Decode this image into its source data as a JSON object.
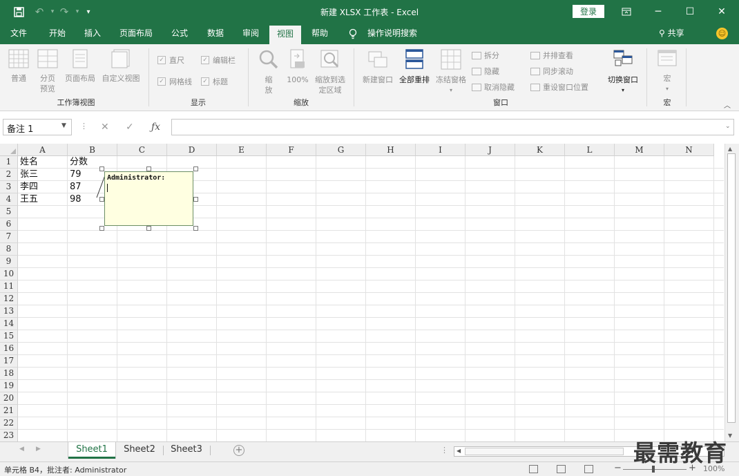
{
  "app": {
    "title": "新建 XLSX 工作表 - Excel",
    "login_label": "登录"
  },
  "menu": {
    "tabs": [
      "文件",
      "开始",
      "插入",
      "页面布局",
      "公式",
      "数据",
      "审阅",
      "视图",
      "帮助"
    ],
    "active": "视图",
    "tell_me": "操作说明搜索",
    "share": "共享"
  },
  "ribbon": {
    "workbook_views": {
      "label": "工作簿视图",
      "buttons": [
        "普通",
        "分页预览",
        "页面布局",
        "自定义视图"
      ]
    },
    "show": {
      "label": "显示",
      "checks": [
        "直尺",
        "编辑栏",
        "网格线",
        "标题"
      ]
    },
    "zoom": {
      "label": "缩放",
      "buttons": [
        "缩放",
        "100%",
        "缩放到选定区域"
      ]
    },
    "window": {
      "label": "窗口",
      "buttons": [
        "新建窗口",
        "全部重排",
        "冻结窗格",
        "拆分",
        "隐藏",
        "取消隐藏",
        "并排查看",
        "同步滚动",
        "重设窗口位置",
        "切换窗口"
      ]
    },
    "macros": {
      "label": "宏",
      "buttons": [
        "宏"
      ]
    }
  },
  "formula_bar": {
    "name_box": "备注 1",
    "content": ""
  },
  "grid": {
    "columns": [
      "A",
      "B",
      "C",
      "D",
      "E",
      "F",
      "G",
      "H",
      "I",
      "J",
      "K",
      "L",
      "M",
      "N"
    ],
    "rows": [
      "1",
      "2",
      "3",
      "4",
      "5",
      "6",
      "7",
      "8",
      "9",
      "10",
      "11",
      "12",
      "13",
      "14",
      "15",
      "16",
      "17",
      "18",
      "19",
      "20",
      "21",
      "22",
      "23"
    ],
    "cells": [
      [
        "姓名",
        "分数"
      ],
      [
        "张三",
        "79"
      ],
      [
        "李四",
        "87"
      ],
      [
        "王五",
        "98"
      ]
    ]
  },
  "comment": {
    "author": "Administrator:",
    "text": ""
  },
  "sheets": {
    "tabs": [
      "Sheet1",
      "Sheet2",
      "Sheet3"
    ],
    "active": "Sheet1"
  },
  "status": {
    "text": "单元格 B4，批注者: Administrator",
    "zoom": "100%"
  },
  "watermark": "最需教育",
  "colors": {
    "accent": "#217346",
    "comment_bg": "#ffffe1"
  }
}
